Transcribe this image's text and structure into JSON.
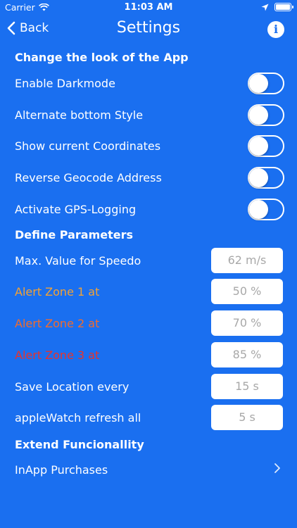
{
  "status_bar": {
    "carrier": "Carrier",
    "time": "11:03 AM"
  },
  "nav": {
    "back_label": "Back",
    "title": "Settings",
    "info_icon": "info-icon"
  },
  "sections": {
    "look": "Change the look of the App",
    "parameters": "Define Parameters",
    "extend": "Extend Funcionallity"
  },
  "toggles": [
    {
      "label": "Enable Darkmode",
      "on": false
    },
    {
      "label": "Alternate bottom Style",
      "on": false
    },
    {
      "label": "Show current Coordinates",
      "on": false
    },
    {
      "label": "Reverse Geocode Address",
      "on": false
    },
    {
      "label": "Activate GPS-Logging",
      "on": false
    }
  ],
  "parameters": [
    {
      "label": "Max. Value for Speedo",
      "placeholder": "62 m/s",
      "color": "#ffffff"
    },
    {
      "label": "Alert Zone 1 at",
      "placeholder": "50 %",
      "color": "#f4a233"
    },
    {
      "label": "Alert Zone 2 at",
      "placeholder": "70 %",
      "color": "#f26b2c"
    },
    {
      "label": "Alert Zone 3 at",
      "placeholder": "85 %",
      "color": "#e8332b"
    },
    {
      "label": "Save Location every",
      "placeholder": "15 s",
      "color": "#ffffff"
    },
    {
      "label": "appleWatch refresh all",
      "placeholder": "5 s",
      "color": "#ffffff"
    }
  ],
  "extend_items": [
    {
      "label": "InApp Purchases"
    }
  ],
  "colors": {
    "background": "#1a6ff0",
    "field_text": "#a8a8a8"
  }
}
